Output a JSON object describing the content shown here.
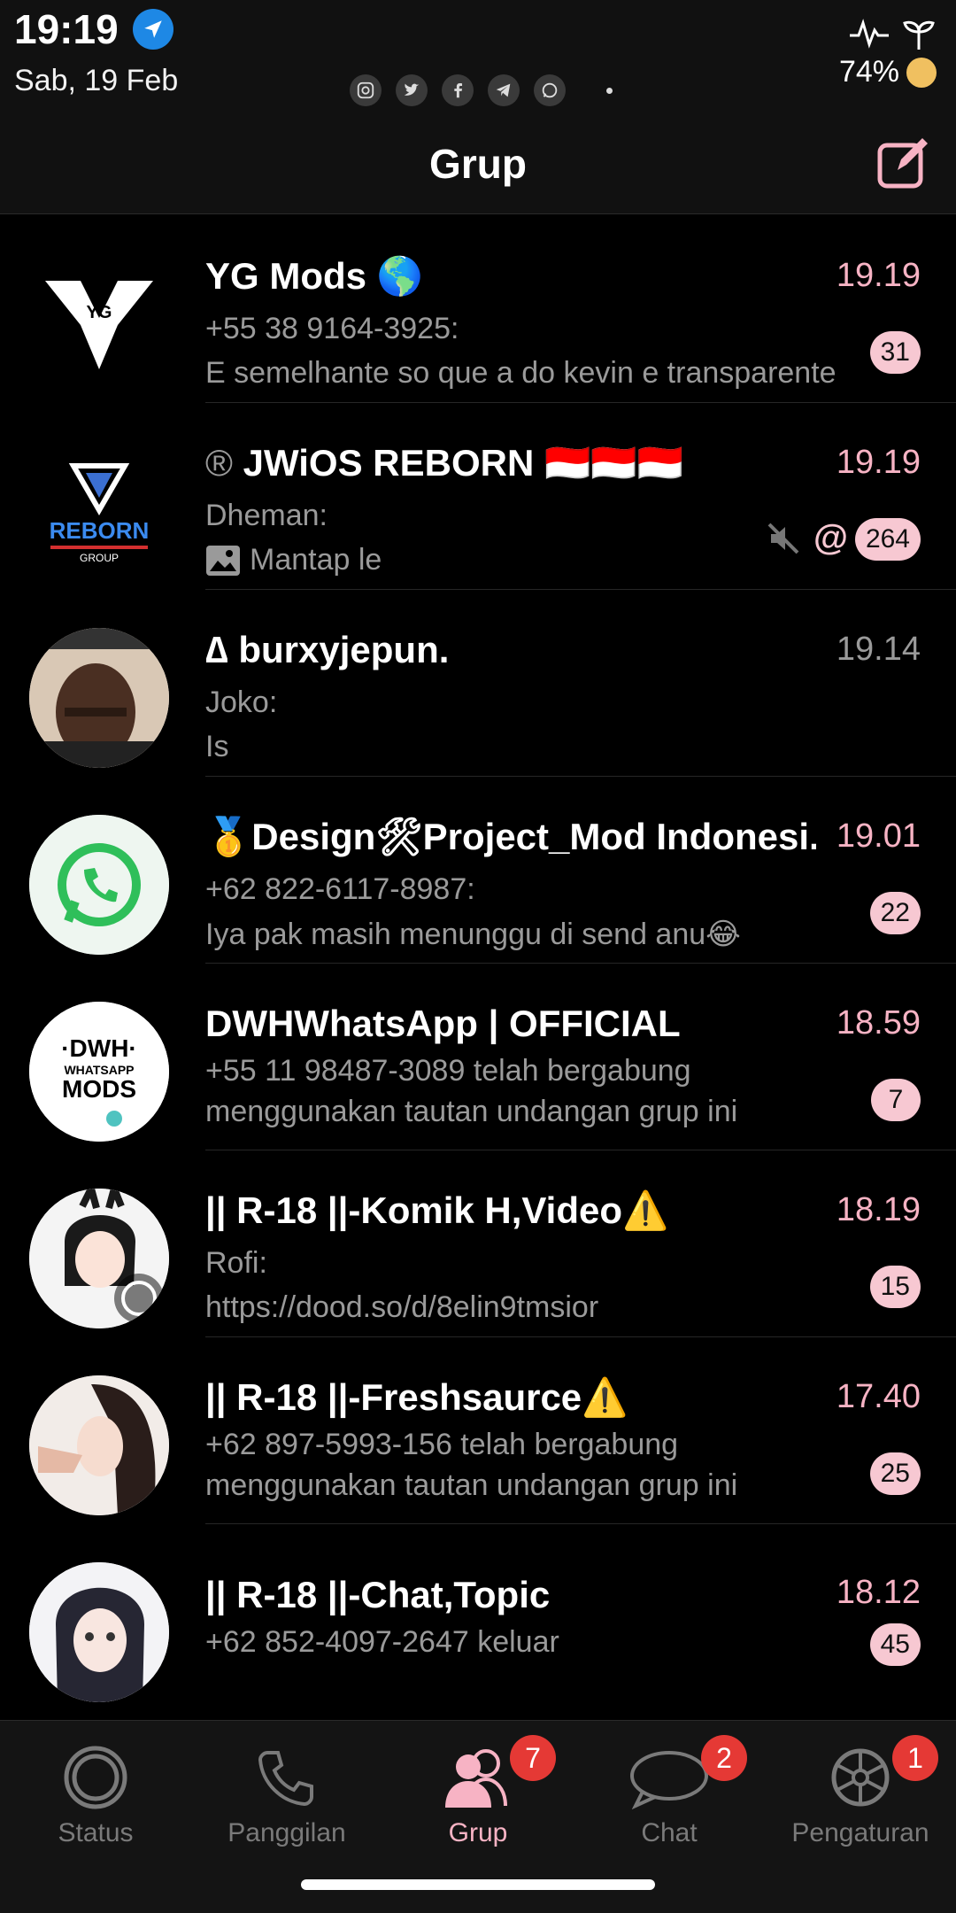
{
  "status_bar": {
    "time": "19:19",
    "date": "Sab, 19 Feb",
    "battery": "74%",
    "notification_apps": [
      "instagram-icon",
      "twitter-icon",
      "facebook-icon",
      "telegram-icon",
      "whatsapp-icon"
    ]
  },
  "header": {
    "title": "Grup"
  },
  "chats": [
    {
      "title": "YG Mods 🌎",
      "time": "19.19",
      "line1": "+55 38 9164-3925:",
      "line2": "E semelhante so que a do kevin e transparente",
      "badge": "31"
    },
    {
      "title": "JWiOS REBORN 🇮🇩🇮🇩🇮🇩",
      "time": "19.19",
      "line1": "Dheman:",
      "line2": "Mantap le",
      "badge": "264"
    },
    {
      "title": "∆ burxyjepun.",
      "time": "19.14",
      "line1": "Joko:",
      "line2": "Is",
      "badge": ""
    },
    {
      "title": "🥇Design🛠Project_Mod Indonesi...",
      "time": "19.01",
      "line1": "+62 822-6117-8987:",
      "line2": "Iya pak masih menunggu di send anu😂",
      "badge": "22"
    },
    {
      "title": "DWHWhatsApp | OFFICIAL",
      "time": "18.59",
      "line1": "+55 11 98487-3089 telah bergabung",
      "line2": "menggunakan tautan undangan grup ini",
      "badge": "7"
    },
    {
      "title": "|| R-18 ||-Komik H,Video⚠️",
      "time": "18.19",
      "line1": "Rofi:",
      "line2": "https://dood.so/d/8elin9tmsior",
      "badge": "15"
    },
    {
      "title": "|| R-18 ||-Freshsaurce⚠️",
      "time": "17.40",
      "line1": "+62 897-5993-156 telah bergabung",
      "line2": "menggunakan tautan undangan grup ini",
      "badge": "25"
    },
    {
      "title": "|| R-18 ||-Chat,Topic",
      "time": "18.12",
      "line1": "+62 852-4097-2647 keluar",
      "line2": "",
      "badge": "45"
    }
  ],
  "avatar_texts": {
    "yg": "YG",
    "reborn": "REBORN",
    "reborn_sub": "GROUP",
    "dwh1": "·DWH·",
    "dwh2": "WHATSAPP",
    "dwh3": "MODS"
  },
  "tabs": [
    {
      "label": "Status",
      "badge": ""
    },
    {
      "label": "Panggilan",
      "badge": ""
    },
    {
      "label": "Grup",
      "badge": "7"
    },
    {
      "label": "Chat",
      "badge": "2"
    },
    {
      "label": "Pengaturan",
      "badge": "1"
    }
  ],
  "colors": {
    "accent": "#f7b3c4",
    "badge_bg": "#f7c8d2",
    "tab_badge": "#e53935"
  }
}
